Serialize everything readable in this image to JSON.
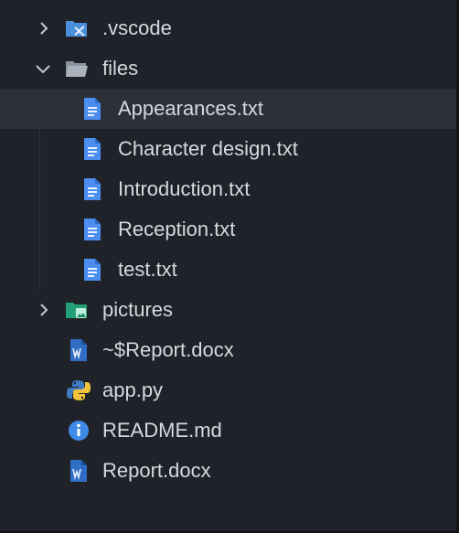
{
  "explorer": {
    "items": [
      {
        "label": ".vscode",
        "icon": "vscode-folder-icon",
        "type": "folder",
        "expanded": false
      },
      {
        "label": "files",
        "icon": "folder-open-icon",
        "type": "folder",
        "expanded": true
      },
      {
        "label": "Appearances.txt",
        "icon": "text-file-icon",
        "type": "file",
        "selected": true
      },
      {
        "label": "Character design.txt",
        "icon": "text-file-icon",
        "type": "file"
      },
      {
        "label": "Introduction.txt",
        "icon": "text-file-icon",
        "type": "file"
      },
      {
        "label": "Reception.txt",
        "icon": "text-file-icon",
        "type": "file"
      },
      {
        "label": "test.txt",
        "icon": "text-file-icon",
        "type": "file"
      },
      {
        "label": "pictures",
        "icon": "image-folder-icon",
        "type": "folder",
        "expanded": false
      },
      {
        "label": "~$Report.docx",
        "icon": "word-file-icon",
        "type": "file"
      },
      {
        "label": "app.py",
        "icon": "python-file-icon",
        "type": "file"
      },
      {
        "label": "README.md",
        "icon": "info-file-icon",
        "type": "file"
      },
      {
        "label": "Report.docx",
        "icon": "word-file-icon",
        "type": "file"
      }
    ]
  },
  "colors": {
    "background": "#1f2228",
    "selected_row": "#2c3038",
    "text": "#d6d9df",
    "text_file_icon": "#4c8df0",
    "word_icon": "#2f6ec4",
    "vscode_folder": "#4a8fd9",
    "image_folder": "#24a078",
    "folder_grey": "#9aa2ae",
    "python_blue": "#3f7bc0",
    "python_yellow": "#f2c33a",
    "info_blue": "#3e8ae6"
  }
}
